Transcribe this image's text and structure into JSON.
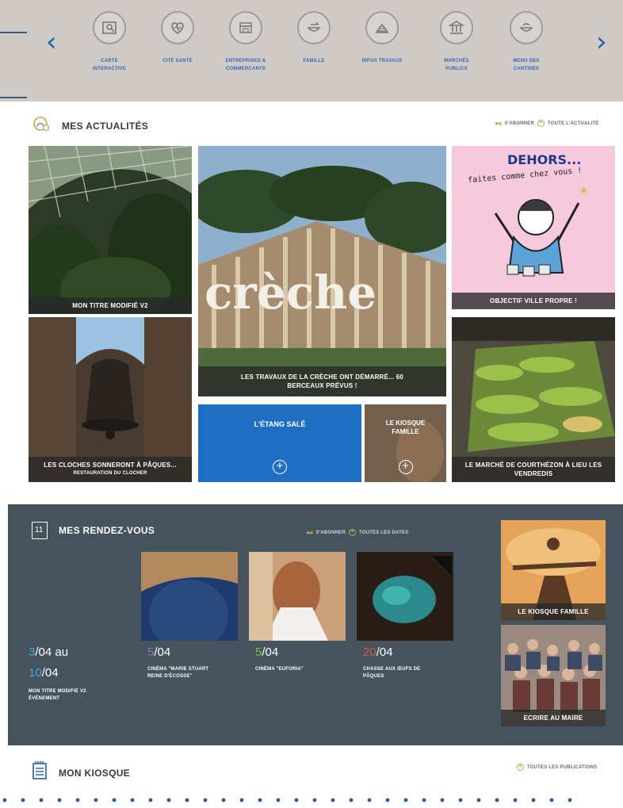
{
  "services": {
    "prev_arrow": "‹",
    "next_arrow": "›",
    "items": [
      {
        "label": "CARTE\nINTERACTIVE",
        "icon": "map-icon"
      },
      {
        "label": "CITÉ SANTÉ",
        "icon": "health-icon"
      },
      {
        "label": "ENTREPRISES &\nCOMMERCANTS",
        "icon": "shop-icon"
      },
      {
        "label": "FAMILLE",
        "icon": "family-icon"
      },
      {
        "label": "INFOS TRAVAUX",
        "icon": "works-icon"
      },
      {
        "label": "MARCHÉS\nPUBLICS",
        "icon": "public-building-icon"
      },
      {
        "label": "MENU DES\nCANTINES",
        "icon": "canteen-icon"
      }
    ]
  },
  "news": {
    "title": "MES ACTUALITÉS",
    "subscribe": "S'ABONNER",
    "all_link": "TOUTE L'ACTUALITÉ",
    "tiles": {
      "greenhouse": "MON TITRE MODIFIÉ V2",
      "creche": "LES TRAVAUX DE LA CRÈCHE ONT DÉMARRÉ... 60 BERCEAUX PRÉVUS !",
      "ville_propre": "OBJECTIF VILLE PROPRE !",
      "poster_title": "DEHORS...",
      "poster_sub": "faites comme chez vous !",
      "cloches": "LES CLOCHES SONNERONT À PÂQUES...",
      "cloches_sub": "RESTAURATION DU CLOCHER",
      "etang": "L'ÉTANG SALÉ",
      "kiosque": "LE KIOSQUE FAMILLE",
      "marche": "LE MARCHÉ DE COURTHÉZON À LIEU LES VENDREDIS",
      "creche_sign": "crèche"
    }
  },
  "rdv": {
    "title": "MES RENDEZ-VOUS",
    "subscribe": "S'ABONNER",
    "all_link": "TOUTES LES DATES",
    "calendar_day": "11",
    "event1": {
      "d1": "3",
      "m1": "/04 au",
      "d2": "10",
      "m2": "/04",
      "title": "MON TITRE MODIFIÉ V2\nÉVÉNEMENT"
    },
    "event2": {
      "day": "5",
      "month": "/04",
      "title": "CINÉMA \"MARIE STUART\nREINE D'ÉCOSSE\""
    },
    "event3": {
      "day": "5",
      "month": "/04",
      "title": "CINÉMA \"EUFORIA\""
    },
    "event4": {
      "day": "20",
      "month": "/04",
      "title": "CHASSE AUX ŒUFS DE\nPÂQUES"
    },
    "side1": "LE KIOSQUE FAMILLE",
    "side2": "ECRIRE AU MAIRE"
  },
  "kiosque": {
    "title": "MON KIOSQUE",
    "all_link": "TOUTES LES PUBLICATIONS"
  },
  "colors": {
    "accent_blue": "#1f5fa8",
    "gold": "#c3a64b",
    "rdv_bg": "#45535c"
  }
}
